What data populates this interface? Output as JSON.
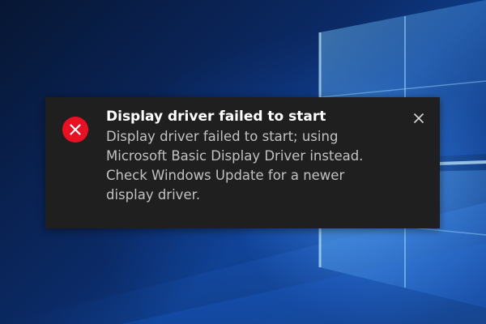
{
  "toast": {
    "title": "Display driver failed to start",
    "body_lines": [
      "Display driver failed to start; using",
      "Microsoft Basic Display Driver instead.",
      "Check Windows Update for a newer",
      "display driver."
    ],
    "icon": "error-icon",
    "close_icon": "close-icon"
  },
  "colors": {
    "toast_background": "#1f1f1f",
    "title_text": "#ffffff",
    "body_text": "#c2c2c2",
    "error_icon": "#e81123",
    "desktop_background": "#0d3a85"
  },
  "desktop": {
    "wallpaper": "windows-logo-wallpaper"
  }
}
